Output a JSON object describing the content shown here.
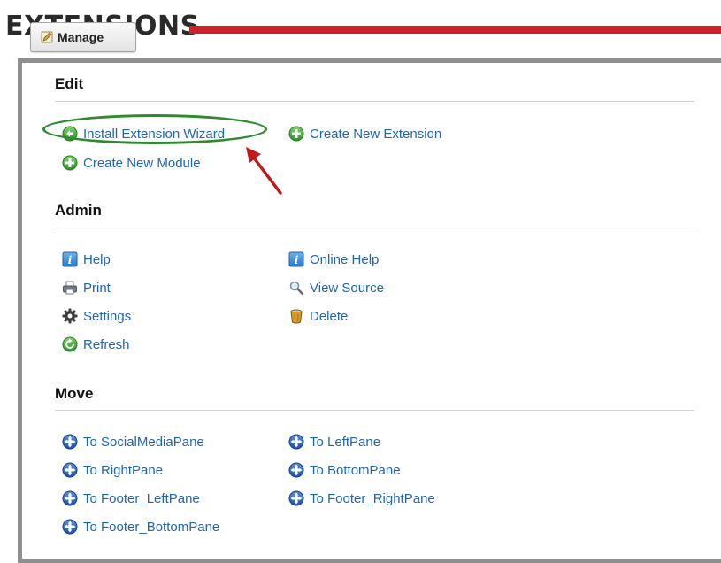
{
  "header": {
    "heading": "EXTENSIONS",
    "manage_label": "Manage"
  },
  "sections": {
    "edit": {
      "title": "Edit",
      "install_wizard": "Install Extension Wizard",
      "create_extension": "Create New Extension",
      "create_module": "Create New Module"
    },
    "admin": {
      "title": "Admin",
      "help": "Help",
      "online_help": "Online Help",
      "print": "Print",
      "view_source": "View Source",
      "settings": "Settings",
      "delete": "Delete",
      "refresh": "Refresh"
    },
    "move": {
      "title": "Move",
      "social_media": "To SocialMediaPane",
      "left": "To LeftPane",
      "right": "To RightPane",
      "bottom": "To BottomPane",
      "footer_left": "To Footer_LeftPane",
      "footer_right": "To Footer_RightPane",
      "footer_bottom": "To Footer_BottomPane"
    }
  },
  "icons": {
    "install": "install-icon",
    "add": "add-icon",
    "help": "help-icon",
    "print": "print-icon",
    "view_source": "magnifier-icon",
    "settings": "gear-icon",
    "delete": "trash-icon",
    "refresh": "refresh-icon",
    "move": "move-icon",
    "manage": "pencil-icon"
  },
  "colors": {
    "link": "#1e64b9",
    "accent_bar": "#c9242b",
    "highlight": "#2d8a2d",
    "arrow": "#c01a1a"
  }
}
